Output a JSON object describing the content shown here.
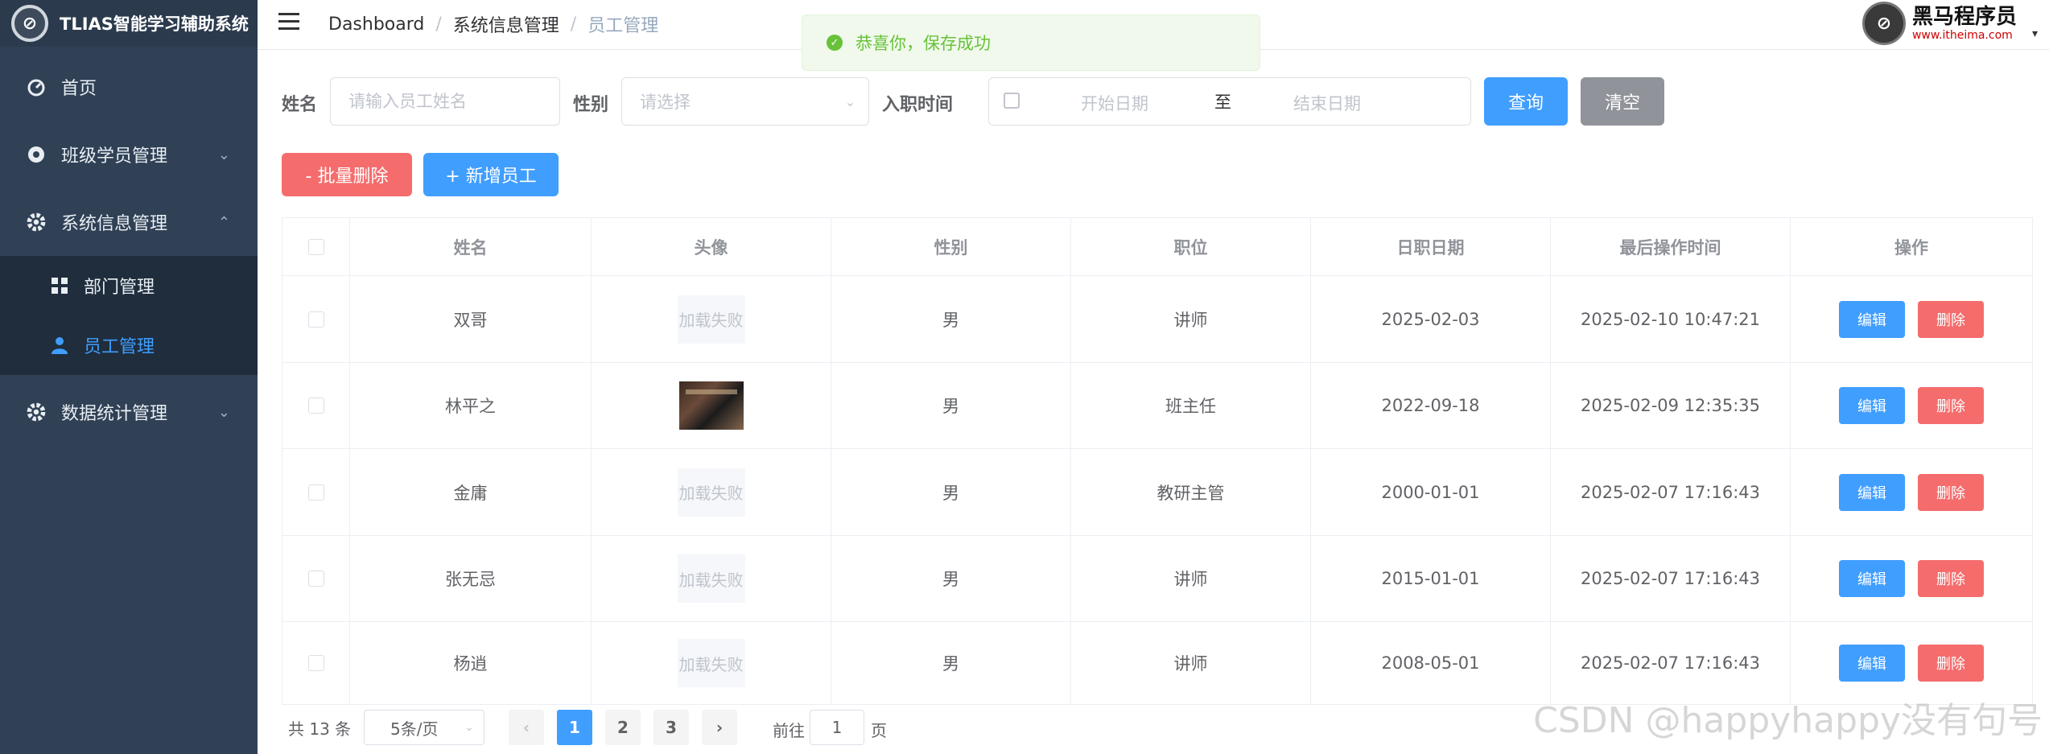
{
  "app": {
    "title": "TLIAS智能学习辅助系统",
    "logo_glyph": "⊘"
  },
  "sidebar": {
    "items": [
      {
        "label": "首页",
        "icon": "dashboard-icon"
      },
      {
        "label": "班级学员管理",
        "icon": "aperture-icon"
      },
      {
        "label": "系统信息管理",
        "icon": "gear-icon",
        "expanded": true,
        "children": [
          {
            "label": "部门管理",
            "icon": "grid-icon"
          },
          {
            "label": "员工管理",
            "icon": "user-icon",
            "active": true
          }
        ]
      },
      {
        "label": "数据统计管理",
        "icon": "gear-icon"
      }
    ]
  },
  "header": {
    "breadcrumb": [
      "Dashboard",
      "系统信息管理",
      "员工管理"
    ],
    "brand_name": "黑马程序员",
    "brand_url": "www.itheima.com"
  },
  "toast": {
    "message": "恭喜你，保存成功",
    "type": "success"
  },
  "search": {
    "name_label": "姓名",
    "name_placeholder": "请输入员工姓名",
    "gender_label": "性别",
    "gender_placeholder": "请选择",
    "date_label": "入职时间",
    "start_placeholder": "开始日期",
    "to_text": "至",
    "end_placeholder": "结束日期",
    "query_label": "查询",
    "clear_label": "清空"
  },
  "actions": {
    "batch_delete": "- 批量删除",
    "add": "+ 新增员工"
  },
  "table": {
    "columns": [
      "姓名",
      "头像",
      "性别",
      "职位",
      "日职日期",
      "最后操作时间",
      "操作"
    ],
    "avatar_fail_text": "加载失败",
    "edit_label": "编辑",
    "delete_label": "删除",
    "rows": [
      {
        "name": "双哥",
        "avatar": "failed",
        "gender": "男",
        "job": "讲师",
        "entry_date": "2025-02-03",
        "update_time": "2025-02-10 10:47:21"
      },
      {
        "name": "林平之",
        "avatar": "image",
        "gender": "男",
        "job": "班主任",
        "entry_date": "2022-09-18",
        "update_time": "2025-02-09 12:35:35"
      },
      {
        "name": "金庸",
        "avatar": "failed",
        "gender": "男",
        "job": "教研主管",
        "entry_date": "2000-01-01",
        "update_time": "2025-02-07 17:16:43"
      },
      {
        "name": "张无忌",
        "avatar": "failed",
        "gender": "男",
        "job": "讲师",
        "entry_date": "2015-01-01",
        "update_time": "2025-02-07 17:16:43"
      },
      {
        "name": "杨逍",
        "avatar": "failed",
        "gender": "男",
        "job": "讲师",
        "entry_date": "2008-05-01",
        "update_time": "2025-02-07 17:16:43"
      }
    ]
  },
  "pagination": {
    "total_text": "共 13 条",
    "page_size": "5条/页",
    "pages": [
      "1",
      "2",
      "3"
    ],
    "current": "1",
    "goto_prefix": "前往",
    "goto_value": "1",
    "goto_suffix": "页"
  },
  "watermark": "CSDN @happyhappy没有句号",
  "colors": {
    "primary": "#409eff",
    "danger": "#f56c6c",
    "sidebar": "#304156",
    "success": "#67c23a"
  }
}
